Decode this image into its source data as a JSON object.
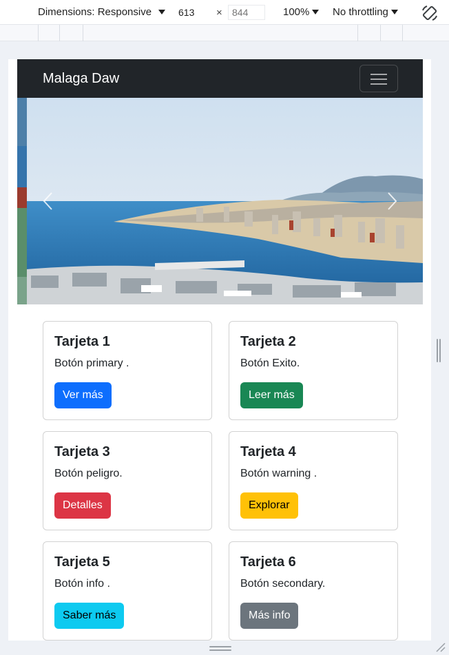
{
  "devtools": {
    "dimensions_label": "Dimensions: Responsive",
    "width_value": "613",
    "height_placeholder": "844",
    "times_symbol": "×",
    "zoom": "100%",
    "throttling": "No throttling"
  },
  "page": {
    "brand": "Malaga Daw",
    "carousel": {
      "image_alt": "Vista panorámica de Málaga"
    },
    "cards": [
      {
        "title": "Tarjeta 1",
        "text": "Botón primary .",
        "button": "Ver más",
        "style": "primary"
      },
      {
        "title": "Tarjeta 2",
        "text": "Botón Exito.",
        "button": "Leer más",
        "style": "success"
      },
      {
        "title": "Tarjeta 3",
        "text": "Botón peligro.",
        "button": "Detalles",
        "style": "danger"
      },
      {
        "title": "Tarjeta 4",
        "text": "Botón warning .",
        "button": "Explorar",
        "style": "warning"
      },
      {
        "title": "Tarjeta 5",
        "text": "Botón info .",
        "button": "Saber más",
        "style": "info"
      },
      {
        "title": "Tarjeta 6",
        "text": "Botón secondary.",
        "button": "Más info",
        "style": "secondary"
      }
    ]
  },
  "colors": {
    "navbar": "#212529",
    "primary": "#0d6efd",
    "success": "#198754",
    "danger": "#dc3545",
    "warning": "#ffc107",
    "info": "#0dcaf0",
    "secondary": "#6c757d"
  },
  "icons": {
    "dimensions_caret": "chevron-down-icon",
    "rotate": "rotate-icon",
    "menu": "hamburger-menu-icon",
    "prev": "chevron-left-icon",
    "next": "chevron-right-icon"
  }
}
